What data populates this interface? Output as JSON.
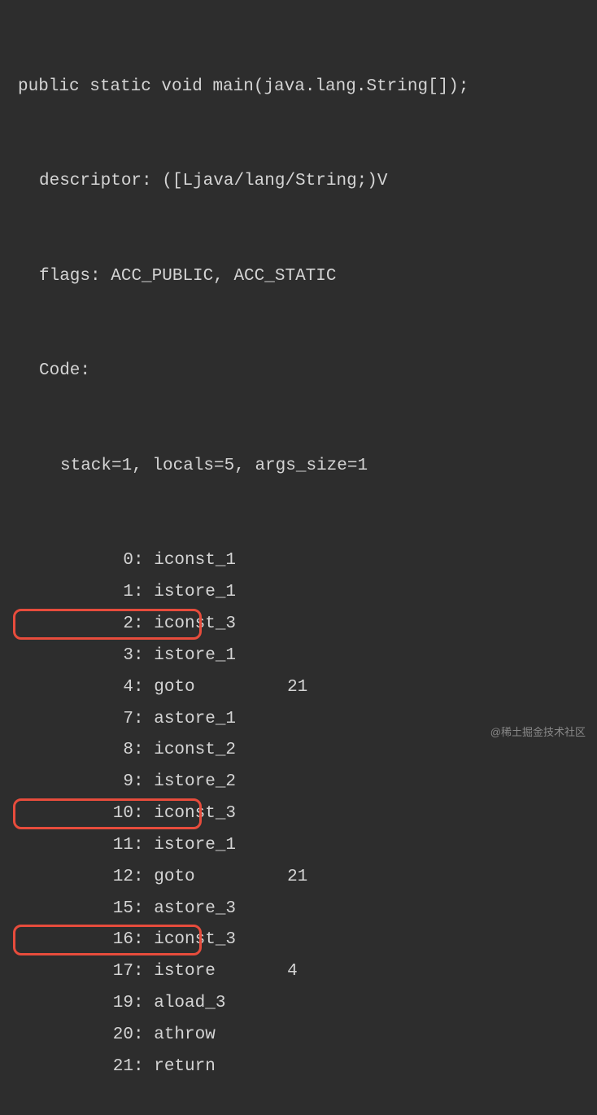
{
  "header": {
    "signature": "public static void main(java.lang.String[]);",
    "descriptor_label": "descriptor:",
    "descriptor_value": "([Ljava/lang/String;)V",
    "flags_label": "flags:",
    "flags_value": "ACC_PUBLIC, ACC_STATIC",
    "code_label": "Code:",
    "stack_info": "stack=1, locals=5, args_size=1"
  },
  "instructions": [
    {
      "offset": "0",
      "opcode": "iconst_1",
      "operand": "",
      "highlighted": false
    },
    {
      "offset": "1",
      "opcode": "istore_1",
      "operand": "",
      "highlighted": false
    },
    {
      "offset": "2",
      "opcode": "iconst_3",
      "operand": "",
      "highlighted": true
    },
    {
      "offset": "3",
      "opcode": "istore_1",
      "operand": "",
      "highlighted": false
    },
    {
      "offset": "4",
      "opcode": "goto",
      "operand": "21",
      "highlighted": false
    },
    {
      "offset": "7",
      "opcode": "astore_1",
      "operand": "",
      "highlighted": false
    },
    {
      "offset": "8",
      "opcode": "iconst_2",
      "operand": "",
      "highlighted": false
    },
    {
      "offset": "9",
      "opcode": "istore_2",
      "operand": "",
      "highlighted": false
    },
    {
      "offset": "10",
      "opcode": "iconst_3",
      "operand": "",
      "highlighted": true
    },
    {
      "offset": "11",
      "opcode": "istore_1",
      "operand": "",
      "highlighted": false
    },
    {
      "offset": "12",
      "opcode": "goto",
      "operand": "21",
      "highlighted": false
    },
    {
      "offset": "15",
      "opcode": "astore_3",
      "operand": "",
      "highlighted": false
    },
    {
      "offset": "16",
      "opcode": "iconst_3",
      "operand": "",
      "highlighted": true
    },
    {
      "offset": "17",
      "opcode": "istore",
      "operand": "4",
      "highlighted": false
    },
    {
      "offset": "19",
      "opcode": "aload_3",
      "operand": "",
      "highlighted": false
    },
    {
      "offset": "20",
      "opcode": "athrow",
      "operand": "",
      "highlighted": false
    },
    {
      "offset": "21",
      "opcode": "return",
      "operand": "",
      "highlighted": false
    }
  ],
  "watermark": "@稀土掘金技术社区"
}
